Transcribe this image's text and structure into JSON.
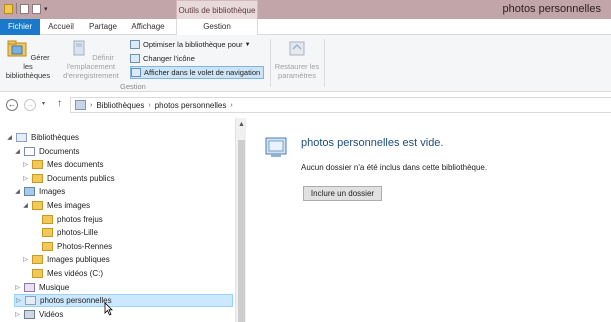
{
  "window": {
    "title": "photos personnelles"
  },
  "ribbon_tabs": {
    "context_label": "Outils de bibliothèque",
    "file": "Fichier",
    "home": "Accueil",
    "share": "Partage",
    "view": "Affichage",
    "manage": "Gestion"
  },
  "ribbon": {
    "manage_libraries": "Gérer les bibliothèques",
    "save_location": "Définir l'emplacement d'enregistrement",
    "optimize": "Optimiser la bibliothèque pour",
    "change_icon": "Changer l'icône",
    "show_nav": "Afficher dans le volet de navigation",
    "restore": "Restaurer les paramètres",
    "group": "Gestion"
  },
  "address": {
    "crumbs": [
      "Bibliothèques",
      "photos personnelles"
    ],
    "sep": "›"
  },
  "tree": [
    {
      "label": "Bibliothèques",
      "level": 0,
      "exp": "◢",
      "icon": "lib"
    },
    {
      "label": "Documents",
      "level": 1,
      "exp": "◢",
      "icon": "doc"
    },
    {
      "label": "Mes documents",
      "level": 2,
      "exp": "▷",
      "icon": "folder"
    },
    {
      "label": "Documents publics",
      "level": 2,
      "exp": "▷",
      "icon": "folder"
    },
    {
      "label": "Images",
      "level": 1,
      "exp": "◢",
      "icon": "img"
    },
    {
      "label": "Mes images",
      "level": 2,
      "exp": "◢",
      "icon": "folder"
    },
    {
      "label": "photos frejus",
      "level": 3,
      "exp": "",
      "icon": "folder"
    },
    {
      "label": "photos-Lille",
      "level": 3,
      "exp": "",
      "icon": "folder"
    },
    {
      "label": "Photos-Rennes",
      "level": 3,
      "exp": "",
      "icon": "folder"
    },
    {
      "label": "Images publiques",
      "level": 2,
      "exp": "▷",
      "icon": "folder"
    },
    {
      "label": "Mes vidéos (C:)",
      "level": 2,
      "exp": "",
      "icon": "folder"
    },
    {
      "label": "Musique",
      "level": 1,
      "exp": "▷",
      "icon": "mus"
    },
    {
      "label": "photos personnelles",
      "level": 1,
      "exp": "▷",
      "icon": "lib",
      "selected": true
    },
    {
      "label": "Vidéos",
      "level": 1,
      "exp": "▷",
      "icon": "vid"
    }
  ],
  "content": {
    "title": "photos personnelles est vide.",
    "message": "Aucun dossier n'a été inclus dans cette bibliothèque.",
    "include_button": "Inclure un dossier"
  }
}
